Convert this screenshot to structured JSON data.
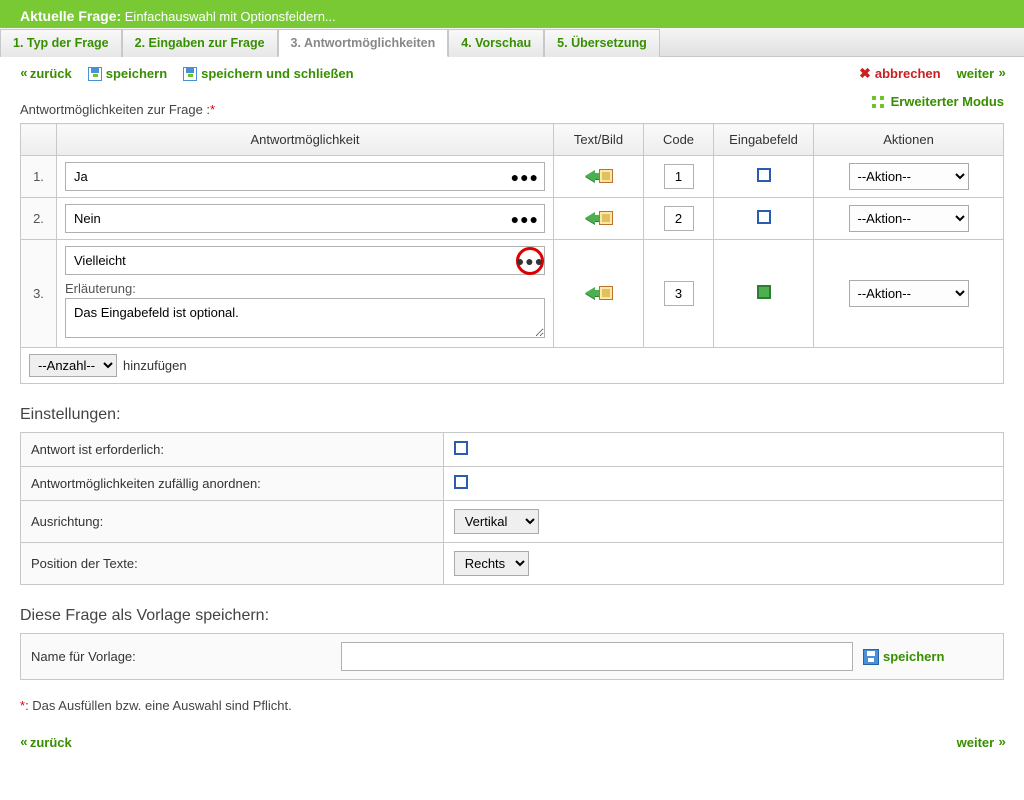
{
  "header": {
    "prefix": "Aktuelle Frage:",
    "title": "Einfachauswahl mit Optionsfeldern..."
  },
  "tabs": [
    "1. Typ der Frage",
    "2. Eingaben zur Frage",
    "3. Antwortmöglichkeiten",
    "4. Vorschau",
    "5. Übersetzung"
  ],
  "toolbar": {
    "back": "zurück",
    "save": "speichern",
    "save_close": "speichern und schließen",
    "cancel": "abbrechen",
    "next": "weiter"
  },
  "advanced_mode": "Erweiterter Modus",
  "section_label": "Antwortmöglichkeiten zur Frage :",
  "columns": {
    "answer": "Antwortmöglichkeit",
    "textimg": "Text/Bild",
    "code": "Code",
    "inputfield": "Eingabefeld",
    "actions": "Aktionen"
  },
  "rows": [
    {
      "num": "1.",
      "answer": "Ja",
      "code": "1",
      "input_checked": false,
      "has_desc": false
    },
    {
      "num": "2.",
      "answer": "Nein",
      "code": "2",
      "input_checked": false,
      "has_desc": false
    },
    {
      "num": "3.",
      "answer": "Vielleicht",
      "code": "3",
      "input_checked": true,
      "has_desc": true,
      "desc_label": "Erläuterung:",
      "desc_text": "Das Eingabefeld ist optional."
    }
  ],
  "action_placeholder": "--Aktion--",
  "add": {
    "count_placeholder": "--Anzahl--",
    "button": "hinzufügen"
  },
  "settings": {
    "title": "Einstellungen:",
    "required": "Antwort ist erforderlich:",
    "shuffle": "Antwortmöglichkeiten zufällig anordnen:",
    "align_label": "Ausrichtung:",
    "align_value": "Vertikal",
    "textpos_label": "Position der Texte:",
    "textpos_value": "Rechts"
  },
  "template": {
    "title": "Diese Frage als Vorlage speichern:",
    "name_label": "Name für Vorlage:",
    "save": "speichern"
  },
  "footnote_marker": "*",
  "footnote_text": ": Das Ausfüllen bzw. eine Auswahl sind Pflicht.",
  "footer": {
    "back": "zurück",
    "next": "weiter"
  }
}
